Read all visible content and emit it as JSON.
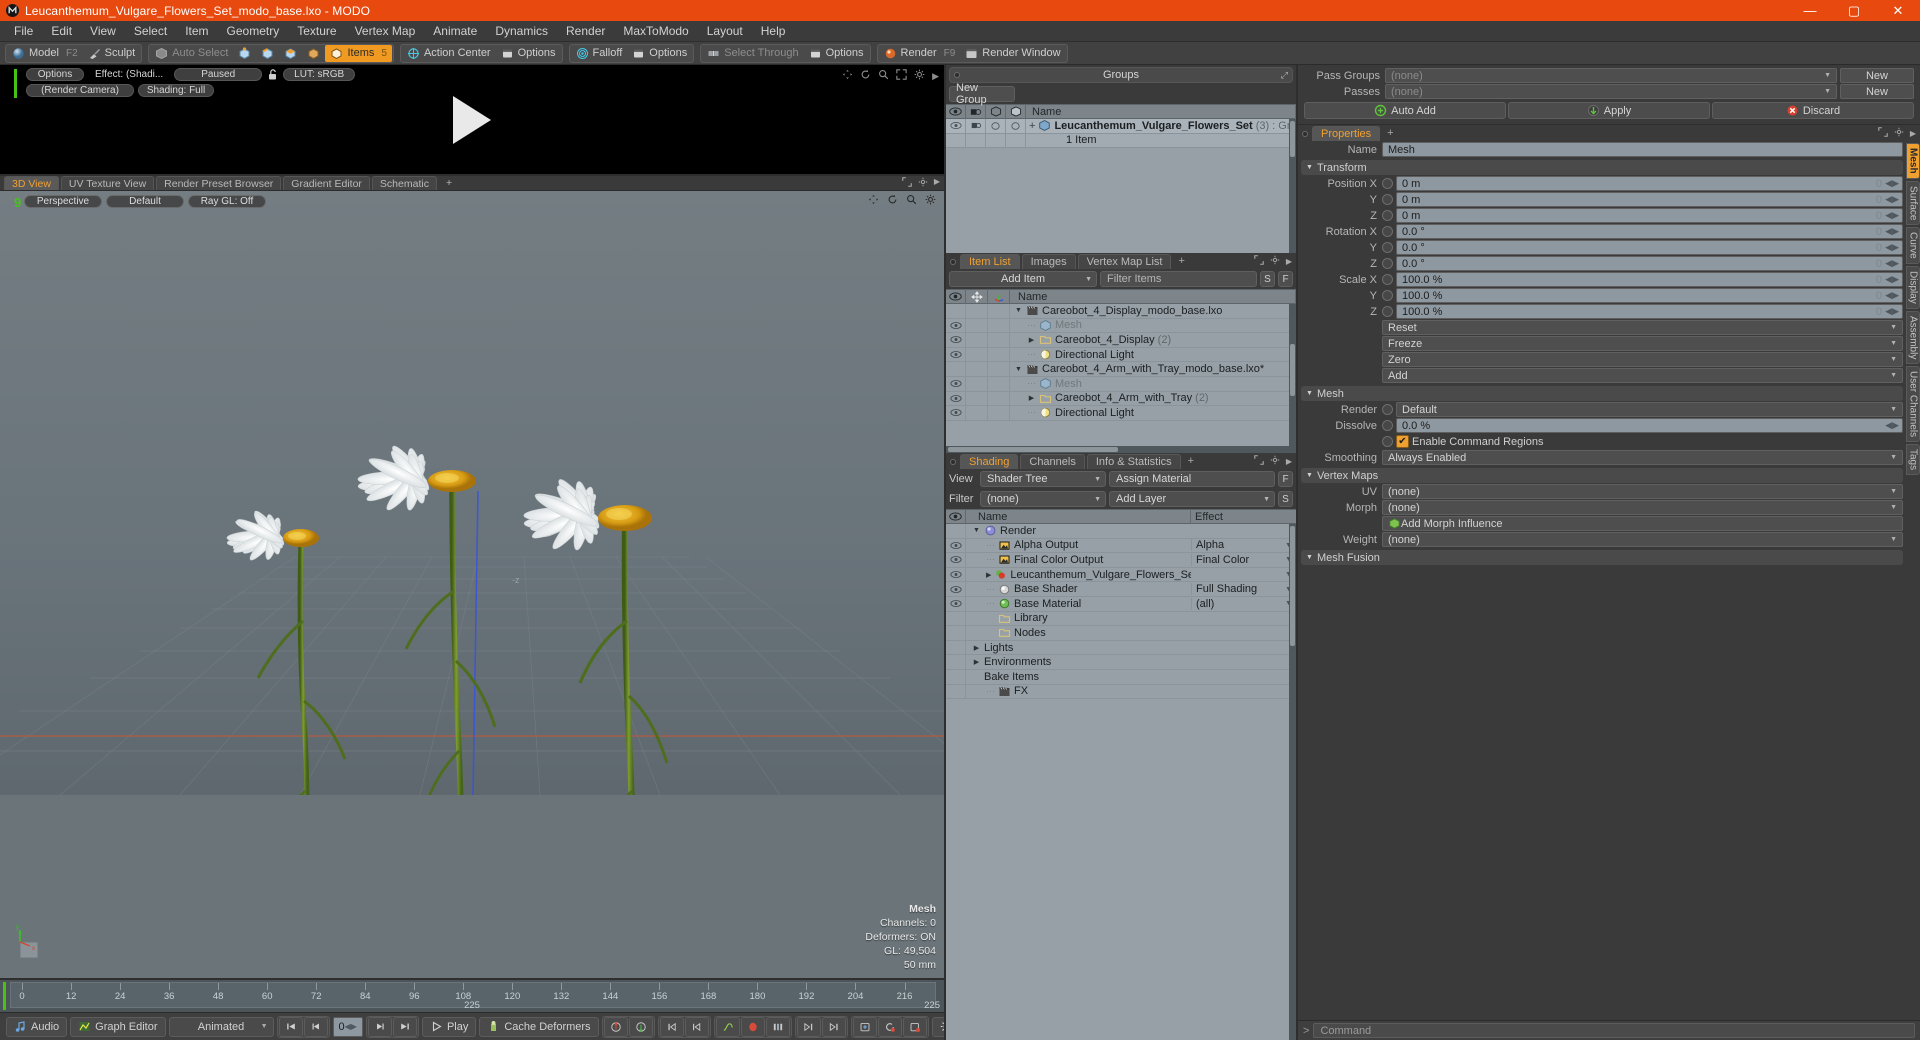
{
  "window": {
    "title": "Leucanthemum_Vulgare_Flowers_Set_modo_base.lxo - MODO",
    "minimize": "—",
    "maximize": "▢",
    "close": "✕"
  },
  "menubar": {
    "items": [
      "File",
      "Edit",
      "View",
      "Select",
      "Item",
      "Geometry",
      "Texture",
      "Vertex Map",
      "Animate",
      "Dynamics",
      "Render",
      "MaxToModo",
      "Layout",
      "Help"
    ]
  },
  "toolbar": {
    "mode_model": "Model",
    "mode_model_key": "F2",
    "mode_sculpt": "Sculpt",
    "auto_select": "Auto Select",
    "items": "Items",
    "items_key": "5",
    "action_center": "Action Center",
    "options1": "Options",
    "falloff": "Falloff",
    "options2": "Options",
    "select_through": "Select Through",
    "options3": "Options",
    "render": "Render",
    "render_key": "F9",
    "render_window": "Render Window"
  },
  "preview": {
    "options": "Options",
    "effect": "Effect: (Shadi...",
    "paused": "Paused",
    "lut": "LUT: sRGB",
    "camera": "(Render Camera)",
    "shading": "Shading: Full"
  },
  "viewport_tabs": {
    "tabs": [
      "3D View",
      "UV Texture View",
      "Render Preset Browser",
      "Gradient Editor",
      "Schematic"
    ],
    "selected": "3D View",
    "plus": "+"
  },
  "viewport": {
    "perspective": "Perspective",
    "default": "Default",
    "raygl": "Ray GL: Off",
    "corner_label": "9",
    "z_label": "-z",
    "stats": {
      "title": "Mesh",
      "channels": "Channels: 0",
      "deformers": "Deformers: ON",
      "gl": "GL: 49,504",
      "scale": "50 mm"
    }
  },
  "timeline": {
    "ticks": [
      "0",
      "12",
      "24",
      "36",
      "48",
      "60",
      "72",
      "84",
      "96",
      "108",
      "120",
      "132",
      "144",
      "156",
      "168",
      "180",
      "192",
      "204",
      "216"
    ],
    "center": "225",
    "end": "225"
  },
  "bottombar": {
    "audio": "Audio",
    "graph_editor": "Graph Editor",
    "animated": "Animated",
    "frame": "0",
    "play": "Play",
    "cache_deformers": "Cache Deformers",
    "settings": "Settings"
  },
  "groups_panel": {
    "title": "Groups",
    "new_group": "New Group",
    "columns": [
      "Name"
    ],
    "rows": [
      {
        "name": "Leucanthemum_Vulgare_Flowers_Set",
        "count": "(3)",
        "suffix": ": Group",
        "sub": "1 Item"
      }
    ]
  },
  "item_list": {
    "tabs": [
      "Item List",
      "Images",
      "Vertex Map List"
    ],
    "selected": "Item List",
    "plus": "+",
    "add_item": "Add Item",
    "filter_placeholder": "Filter Items",
    "btn_s": "S",
    "btn_f": "F",
    "column_name": "Name",
    "rows": [
      {
        "indent": 0,
        "arrow": "▼",
        "icon": "scene-icon",
        "label": "Careobot_4_Display_modo_base.lxo",
        "count": "",
        "muted": false,
        "eye": false
      },
      {
        "indent": 1,
        "arrow": "",
        "icon": "mesh-icon",
        "label": "Mesh",
        "count": "",
        "muted": true,
        "eye": true
      },
      {
        "indent": 1,
        "arrow": "▶",
        "icon": "folder-icon",
        "label": "Careobot_4_Display",
        "count": "(2)",
        "muted": false,
        "eye": true
      },
      {
        "indent": 1,
        "arrow": "",
        "icon": "light-icon",
        "label": "Directional Light",
        "count": "",
        "muted": false,
        "eye": true
      },
      {
        "indent": 0,
        "arrow": "▼",
        "icon": "scene-icon",
        "label": "Careobot_4_Arm_with_Tray_modo_base.lxo*",
        "count": "",
        "muted": false,
        "eye": false
      },
      {
        "indent": 1,
        "arrow": "",
        "icon": "mesh-icon",
        "label": "Mesh",
        "count": "",
        "muted": true,
        "eye": true
      },
      {
        "indent": 1,
        "arrow": "▶",
        "icon": "folder-icon",
        "label": "Careobot_4_Arm_with_Tray",
        "count": "(2)",
        "muted": false,
        "eye": true
      },
      {
        "indent": 1,
        "arrow": "",
        "icon": "light-icon",
        "label": "Directional Light",
        "count": "",
        "muted": false,
        "eye": true
      }
    ]
  },
  "shading_panel": {
    "tabs": [
      "Shading",
      "Channels",
      "Info & Statistics"
    ],
    "selected": "Shading",
    "plus": "+",
    "view_label": "View",
    "view_value": "Shader Tree",
    "assign_material": "Assign Material",
    "filter_label": "Filter",
    "filter_value": "(none)",
    "add_layer": "Add Layer",
    "btn_f": "F",
    "btn_s": "S",
    "col_name": "Name",
    "col_effect": "Effect",
    "rows": [
      {
        "indent": 0,
        "arrow": "▼",
        "icon": "render-icon",
        "label": "Render",
        "effect": "",
        "eye": false,
        "dd": false
      },
      {
        "indent": 1,
        "arrow": "",
        "icon": "output-icon",
        "label": "Alpha Output",
        "effect": "Alpha",
        "eye": true,
        "dd": true
      },
      {
        "indent": 1,
        "arrow": "",
        "icon": "output-icon",
        "label": "Final Color Output",
        "effect": "Final Color",
        "eye": true,
        "dd": true
      },
      {
        "indent": 1,
        "arrow": "▶",
        "icon": "material-icon",
        "label": "Leucanthemum_Vulgare_Flowers_Set (…",
        "effect": "",
        "eye": true,
        "dd": true
      },
      {
        "indent": 1,
        "arrow": "",
        "icon": "shader-icon",
        "label": "Base Shader",
        "effect": "Full Shading",
        "eye": true,
        "dd": true
      },
      {
        "indent": 1,
        "arrow": "",
        "icon": "basemat-icon",
        "label": "Base Material",
        "effect": "(all)",
        "eye": true,
        "dd": true
      },
      {
        "indent": 1,
        "arrow": "",
        "icon": "folder-icon",
        "label": "Library",
        "effect": "",
        "eye": false,
        "dd": false
      },
      {
        "indent": 1,
        "arrow": "",
        "icon": "folder-icon",
        "label": "Nodes",
        "effect": "",
        "eye": false,
        "dd": false
      },
      {
        "indent": 0,
        "arrow": "▶",
        "icon": "",
        "label": "Lights",
        "effect": "",
        "eye": false,
        "dd": false
      },
      {
        "indent": 0,
        "arrow": "▶",
        "icon": "",
        "label": "Environments",
        "effect": "",
        "eye": false,
        "dd": false
      },
      {
        "indent": 0,
        "arrow": "",
        "icon": "",
        "label": "Bake Items",
        "effect": "",
        "eye": false,
        "dd": false
      },
      {
        "indent": 1,
        "arrow": "",
        "icon": "scene-icon",
        "label": "FX",
        "effect": "",
        "eye": false,
        "dd": false
      }
    ]
  },
  "properties": {
    "pass_groups_label": "Pass Groups",
    "pass_groups_value": "(none)",
    "pass_groups_new": "New",
    "passes_label": "Passes",
    "passes_value": "(none)",
    "passes_new": "New",
    "auto_add": "Auto Add",
    "apply": "Apply",
    "discard": "Discard",
    "tab": "Properties",
    "plus": "+",
    "name_label": "Name",
    "name_value": "Mesh",
    "transform_section": "Transform",
    "transform_rows": [
      {
        "label": "Position X",
        "value": "0 m"
      },
      {
        "label": "Y",
        "value": "0 m"
      },
      {
        "label": "Z",
        "value": "0 m"
      },
      {
        "label": "Rotation X",
        "value": "0.0 °"
      },
      {
        "label": "Y",
        "value": "0.0 °"
      },
      {
        "label": "Z",
        "value": "0.0 °"
      },
      {
        "label": "Scale X",
        "value": "100.0 %"
      },
      {
        "label": "Y",
        "value": "100.0 %"
      },
      {
        "label": "Z",
        "value": "100.0 %"
      }
    ],
    "transform_buttons": [
      "Reset",
      "Freeze",
      "Zero",
      "Add"
    ],
    "mesh_section": "Mesh",
    "render_label": "Render",
    "render_value": "Default",
    "dissolve_label": "Dissolve",
    "dissolve_value": "0.0 %",
    "enable_command_regions": "Enable Command Regions",
    "enable_command_regions_checked": true,
    "smoothing_label": "Smoothing",
    "smoothing_value": "Always Enabled",
    "vertex_maps_section": "Vertex Maps",
    "uv_label": "UV",
    "uv_value": "(none)",
    "morph_label": "Morph",
    "morph_value": "(none)",
    "add_morph_influence": "Add Morph Influence",
    "weight_label": "Weight",
    "weight_value": "(none)",
    "mesh_fusion_section": "Mesh Fusion",
    "side_tabs": [
      "Mesh",
      "Surface",
      "Curve",
      "Display",
      "Assembly",
      "User Channels",
      "Tags"
    ],
    "side_tab_selected": "Mesh"
  },
  "command_bar": {
    "arrow": ">",
    "placeholder": "Command"
  },
  "colors": {
    "title_bar": "#e8490e",
    "accent": "#f0a030",
    "panel_bg": "#3a3a3a",
    "list_bg": "#97a0a6",
    "viewport_bg": "#6a7479"
  }
}
